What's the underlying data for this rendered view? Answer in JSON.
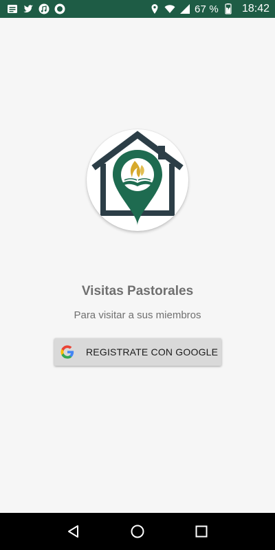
{
  "status_bar": {
    "battery_percent": "67 %",
    "time": "18:42",
    "icons": [
      "notification-icon",
      "twitter-icon",
      "music-icon",
      "record-icon",
      "location-icon",
      "wifi-icon",
      "cell-signal-icon",
      "battery-icon"
    ]
  },
  "app": {
    "title": "Visitas Pastorales",
    "subtitle": "Para visitar a sus miembros",
    "brand_green": "#1e6b50",
    "house_color": "#2c3e47"
  },
  "login": {
    "google_button_label": "REGISTRATE CON GOOGLE"
  },
  "navigation": {
    "buttons": [
      "back-icon",
      "home-icon",
      "recents-icon"
    ]
  }
}
